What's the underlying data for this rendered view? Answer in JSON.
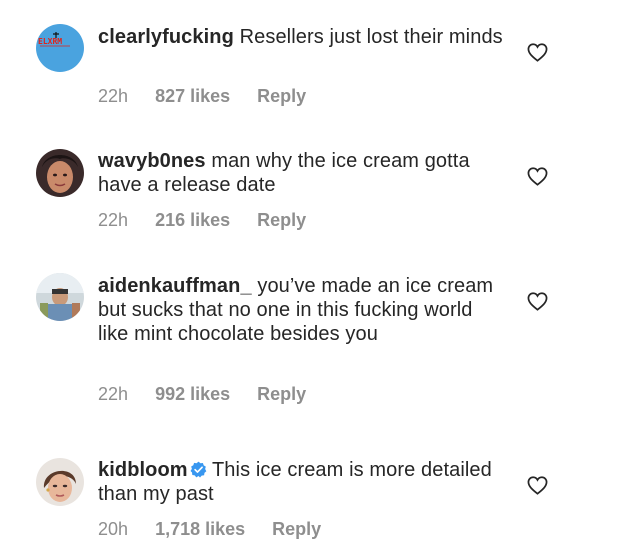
{
  "comments": [
    {
      "username": "clearlyfucking",
      "text": "Resellers just lost their minds",
      "time": "22h",
      "likes": "827 likes",
      "reply": "Reply",
      "avatar_text": "ELXRM"
    },
    {
      "username": "wavyb0nes",
      "text": "man why the ice cream gotta have a release date",
      "time": "22h",
      "likes": "216 likes",
      "reply": "Reply"
    },
    {
      "username": "aidenkauffman_",
      "text": "you’ve made an ice cream but sucks that no one in this fucking world like mint chocolate besides you",
      "time": "22h",
      "likes": "992 likes",
      "reply": "Reply"
    },
    {
      "username": "kidbloom",
      "verified": true,
      "text": "This ice cream is more detailed than my past",
      "time": "20h",
      "likes": "1,718 likes",
      "reply": "Reply"
    }
  ],
  "icons": {
    "like": "heart-outline-icon",
    "verified": "verified-badge-icon"
  },
  "colors": {
    "text": "#262626",
    "meta": "#8e8e8e",
    "verified": "#3897f0",
    "avatar1_bg": "#4aa3df"
  }
}
